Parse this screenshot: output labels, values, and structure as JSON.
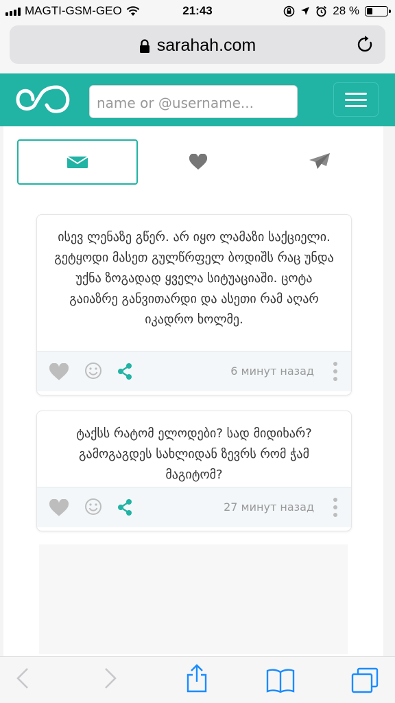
{
  "status_bar": {
    "carrier": "MAGTI-GSM-GEO",
    "time": "21:43",
    "battery_percent": "28 %",
    "battery_level": 0.28,
    "icons": [
      "signal-icon",
      "wifi-icon",
      "rotation-lock-icon",
      "location-icon",
      "alarm-icon",
      "battery-icon"
    ]
  },
  "browser": {
    "url": "sarahah.com",
    "icons": [
      "lock-icon",
      "reload-icon"
    ]
  },
  "nav": {
    "search_placeholder": "name or @username...",
    "icons": [
      "sarahah-logo-icon",
      "hamburger-menu-icon"
    ]
  },
  "tabs": [
    {
      "name": "inbox",
      "icon": "envelope-icon",
      "active": true
    },
    {
      "name": "favorites",
      "icon": "heart-icon",
      "active": false
    },
    {
      "name": "sent",
      "icon": "paper-plane-icon",
      "active": false
    }
  ],
  "messages": [
    {
      "text": "ისევ ლენაზე გწერ. არ იყო ლამაზი საქციელი. გეტყოდი მასეთ გულწრფელ ბოდიშს რაც უნდა უქნა ზოგადად ყველა სიტუაციაში. ცოტა გაიაზრე განვითარდი და ასეთი რამ აღარ იკადრო ხოლმე.",
      "time": "6 минут назад"
    },
    {
      "text": "ტაქსს რატომ ელოდები? სად მიდიხარ? გამოგაგდეს სახლიდან ზევრს რომ ჭამ მაგიტომ?",
      "time": "27 минут назад"
    }
  ],
  "colors": {
    "accent": "#21b3a4",
    "ios_blue": "#1a8cff",
    "icon_gray": "#bdbdbd",
    "text": "#333333"
  }
}
